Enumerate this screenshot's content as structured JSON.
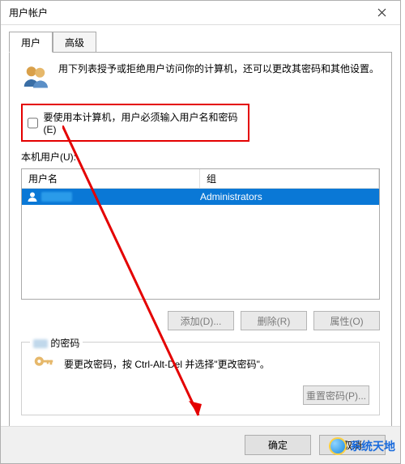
{
  "title": "用户帐户",
  "tabs": {
    "users": "用户",
    "advanced": "高级"
  },
  "intro": "用下列表授予或拒绝用户访问你的计算机，还可以更改其密码和其他设置。",
  "checkbox_label": "要使用本计算机，用户必须输入用户名和密码(E)",
  "users_label": "本机用户(U):",
  "columns": {
    "name": "用户名",
    "group": "组"
  },
  "rows": [
    {
      "name": "",
      "group": "Administrators"
    }
  ],
  "buttons": {
    "add": "添加(D)...",
    "remove": "删除(R)",
    "properties": "属性(O)",
    "reset_pw": "重置密码(P)..."
  },
  "pw_group_suffix": " 的密码",
  "pw_hint": "要更改密码，按 Ctrl-Alt-Del 并选择\"更改密码\"。",
  "footer": {
    "ok": "确定",
    "cancel": "取消"
  },
  "watermark": "系统天地"
}
